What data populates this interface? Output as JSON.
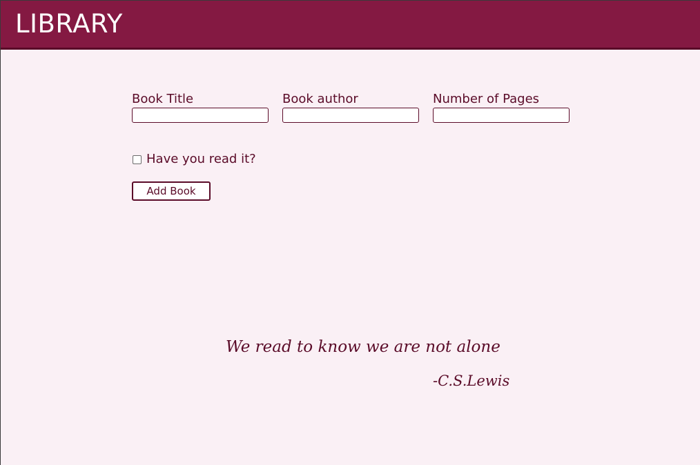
{
  "header": {
    "title": "LIBRARY"
  },
  "form": {
    "fields": [
      {
        "label": "Book Title",
        "value": "",
        "placeholder": ""
      },
      {
        "label": "Book author",
        "value": "",
        "placeholder": ""
      },
      {
        "label": "Number of Pages",
        "value": "",
        "placeholder": ""
      }
    ],
    "read_checkbox": {
      "label": "Have you read it?",
      "checked": false
    },
    "add_button_label": "Add Book"
  },
  "quote": {
    "text": "We read to know we are not alone",
    "author": "-C.S.Lewis"
  },
  "colors": {
    "header_bg": "#841942",
    "accent": "#5a0b28",
    "page_bg": "#faf0f5"
  }
}
